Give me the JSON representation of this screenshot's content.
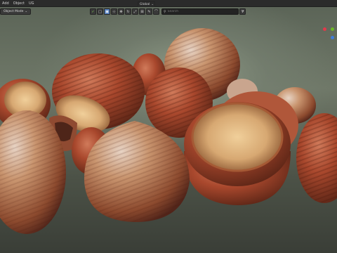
{
  "header": {
    "menu": [
      "Add",
      "Object",
      "UG"
    ]
  },
  "mode": {
    "label": "Object Mode"
  },
  "toolbar": {
    "transform_orientation": "Global",
    "search_placeholder": "Search"
  },
  "gizmo": {
    "x_color": "#e2394b",
    "y_color": "#6cb827",
    "z_color": "#3f7cd8"
  }
}
